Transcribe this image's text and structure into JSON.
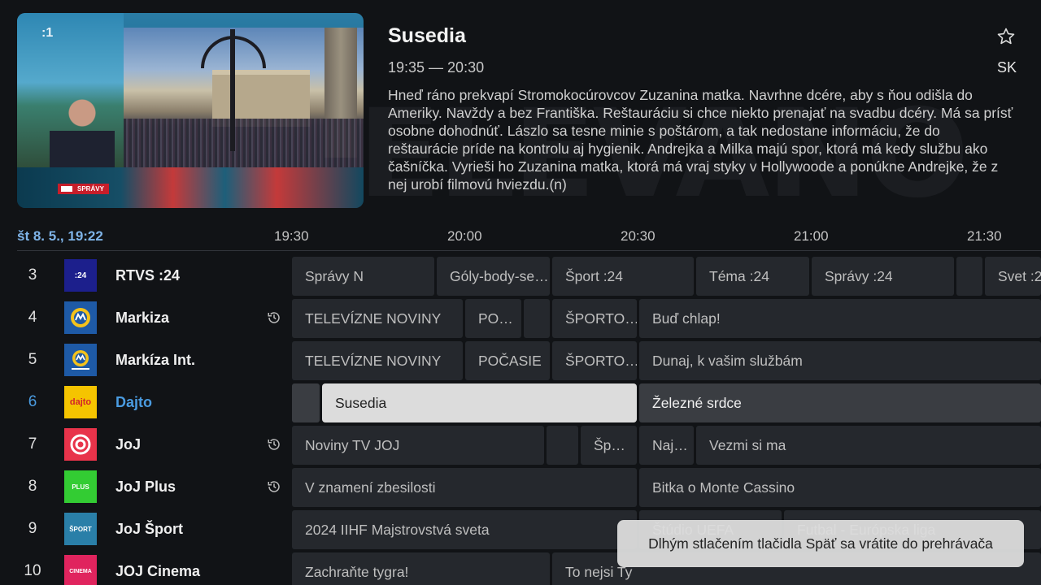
{
  "preview": {
    "channel_number_overlay": ":1",
    "lower_third": "SPRÁVY"
  },
  "info": {
    "title": "Susedia",
    "time": "19:35 — 20:30",
    "description": "Hneď ráno prekvapí Stromokocúrovcov Zuzanina matka. Navrhne dcére, aby s ňou odišla do Ameriky. Navždy a bez Františka. Reštauráciu si chce niekto prenajať na svadbu dcéry. Má sa prísť osobne dohodnúť. Lászlo sa tesne minie s poštárom, a tak nedostane informáciu, že do reštaurácie príde na kontrolu aj hygienik. Andrejka a Milka majú spor, ktorá má kedy službu ako čašníčka. Vyrieši ho Zuzanina matka, ktorá má vraj styky v Hollywoode a ponúkne Andrejke, že z nej urobí filmovú hviezdu.(n)",
    "language": "SK",
    "favorite_icon": "star-outline-icon"
  },
  "background_mark": "ELEVANO",
  "timeline": {
    "date": "št 8. 5., 19:22",
    "ticks": [
      "19:30",
      "20:00",
      "20:30",
      "21:00",
      "21:30"
    ]
  },
  "channels": [
    {
      "number": "3",
      "name": "RTVS :24",
      "logo_text": ":24",
      "logo_color": "#1c1f8c",
      "catchup": false,
      "programs": [
        "Správy N",
        "Góly-body-se…",
        "Šport :24",
        "Téma :24",
        "Správy :24",
        "",
        "Svet :24"
      ]
    },
    {
      "number": "4",
      "name": "Markiza",
      "logo_text": "M",
      "logo_color": "#1e5aa6",
      "catchup": true,
      "programs": [
        "TELEVÍZNE NOVINY",
        "PO…",
        "",
        "ŠPORTO…",
        "Buď chlap!"
      ]
    },
    {
      "number": "5",
      "name": "Markíza Int.",
      "logo_text": "M",
      "logo_color": "#1e5aa6",
      "catchup": false,
      "programs": [
        "TELEVÍZNE NOVINY",
        "POČASIE",
        "ŠPORTO…",
        "Dunaj, k vašim službám"
      ]
    },
    {
      "number": "6",
      "name": "Dajto",
      "logo_text": "dajto",
      "logo_color": "#f5c400",
      "catchup": false,
      "programs": [
        "",
        "Susedia",
        "Železné srdce"
      ]
    },
    {
      "number": "7",
      "name": "JoJ",
      "logo_text": "JOJ",
      "logo_color": "#e8334a",
      "catchup": true,
      "programs": [
        "Noviny TV JOJ",
        "",
        "Šp…",
        "Naj…",
        "Vezmi si ma"
      ]
    },
    {
      "number": "8",
      "name": "JoJ Plus",
      "logo_text": "PLUS",
      "logo_color": "#33cc33",
      "catchup": true,
      "programs": [
        "V znamení zbesilosti",
        "Bitka o Monte Cassino"
      ]
    },
    {
      "number": "9",
      "name": "JoJ Šport",
      "logo_text": "ŠPORT",
      "logo_color": "#2a7fa8",
      "catchup": false,
      "programs": [
        "2024 IIHF Majstrovstvá sveta",
        "Štúdio UEFA",
        "Futbal - Európska liga"
      ]
    },
    {
      "number": "10",
      "name": "JOJ Cinema",
      "logo_text": "CINEMA",
      "logo_color": "#e0245e",
      "catchup": false,
      "programs": [
        "Zachraňte tygra!",
        "To nejsi Ty"
      ]
    }
  ],
  "toast": "Dlhým stlačením tlačidla Späť sa vrátite do prehrávača"
}
